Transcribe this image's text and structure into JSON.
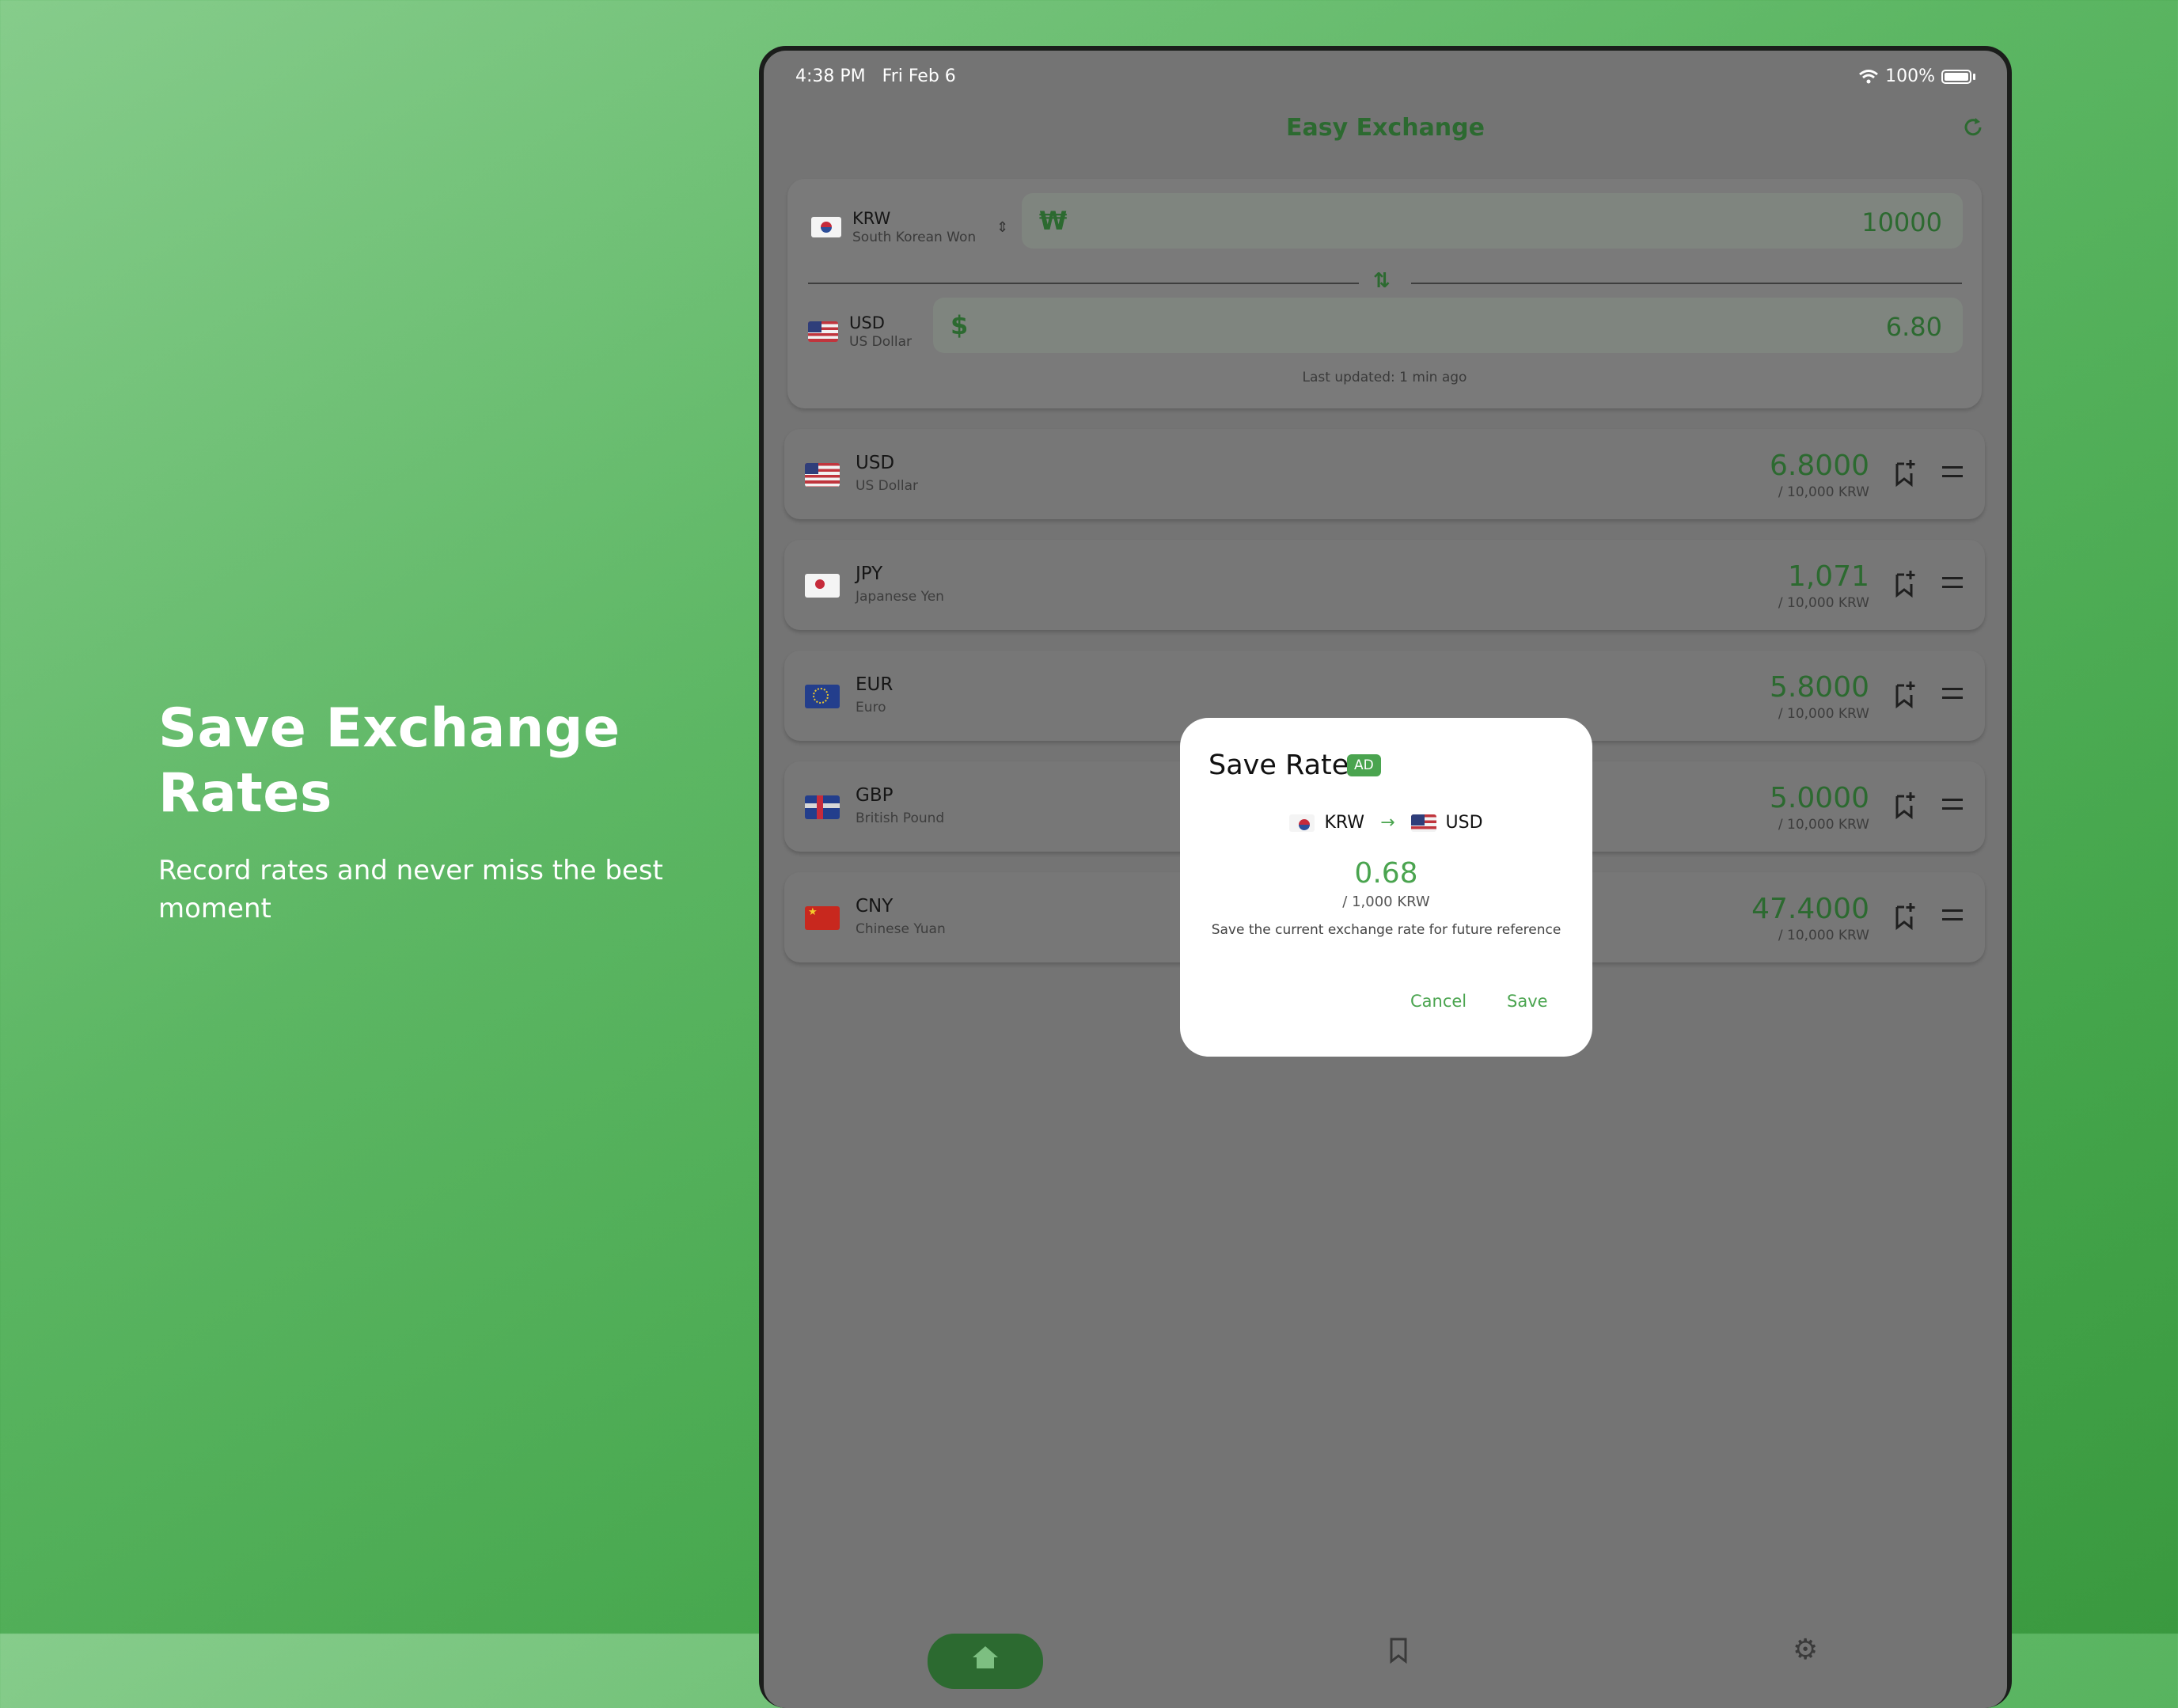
{
  "promo": {
    "title": "Save Exchange Rates",
    "subtitle": "Record rates and never miss the best moment"
  },
  "status_bar": {
    "time": "4:38 PM",
    "date": "Fri Feb 6",
    "battery": "100%"
  },
  "header": {
    "title": "Easy Exchange",
    "refresh_icon": "refresh-icon"
  },
  "converter": {
    "from": {
      "code": "KRW",
      "name": "South Korean Won",
      "symbol": "₩",
      "amount": "10000"
    },
    "to": {
      "code": "USD",
      "name": "US Dollar",
      "symbol": "$",
      "amount": "6.80"
    },
    "last_updated": "Last updated: 1 min ago"
  },
  "rates": [
    {
      "code": "USD",
      "name": "US Dollar",
      "rate": "6.8000",
      "per": "/ 10,000 KRW",
      "flag": "us"
    },
    {
      "code": "JPY",
      "name": "Japanese Yen",
      "rate": "1,071",
      "per": "/ 10,000 KRW",
      "flag": "jp"
    },
    {
      "code": "EUR",
      "name": "Euro",
      "rate": "5.8000",
      "per": "/ 10,000 KRW",
      "flag": "eu"
    },
    {
      "code": "GBP",
      "name": "British Pound",
      "rate": "5.0000",
      "per": "/ 10,000 KRW",
      "flag": "gb"
    },
    {
      "code": "CNY",
      "name": "Chinese Yuan",
      "rate": "47.4000",
      "per": "/ 10,000 KRW",
      "flag": "cn"
    }
  ],
  "dialog": {
    "title": "Save Rate",
    "badge": "AD",
    "from_code": "KRW",
    "to_code": "USD",
    "rate": "0.68",
    "per": "/ 1,000 KRW",
    "description": "Save the current exchange rate for future reference",
    "cancel_label": "Cancel",
    "save_label": "Save"
  },
  "colors": {
    "accent": "#4aa44f",
    "accent_dark": "#2c6a30",
    "background": "#5cb663"
  }
}
